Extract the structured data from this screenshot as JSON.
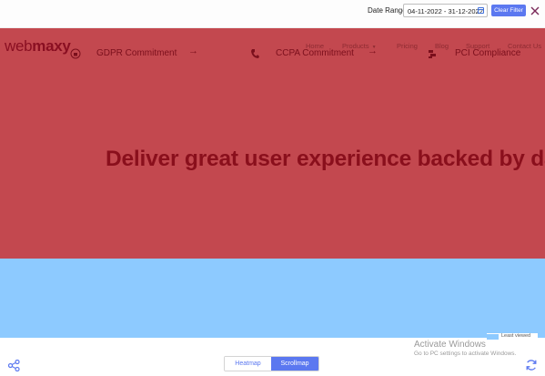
{
  "filter": {
    "label": "Date Range",
    "range": "04-11-2022 - 31-12-2022",
    "clear_label": "Clear Filter"
  },
  "site": {
    "logo_light": "web",
    "logo_bold": "maxy",
    "nav": [
      {
        "label": "Home"
      },
      {
        "label": "Products"
      },
      {
        "label": "Pricing"
      },
      {
        "label": "Blog"
      },
      {
        "label": "Support"
      },
      {
        "label": "Contact Us"
      }
    ],
    "badges": [
      {
        "label": "GDPR Commitment"
      },
      {
        "label": "CCPA Commitment"
      },
      {
        "label": "PCI Compliance"
      }
    ],
    "headline": "Deliver great user experience backed by data"
  },
  "legend_fragment": "Least viewed",
  "watermark": {
    "title": "Activate Windows",
    "subtitle": "Go to PC settings to activate Windows."
  },
  "toggle": {
    "heatmap": "Heatmap",
    "scrollmap": "Scrollmap",
    "active": "Scrollmap"
  },
  "colors": {
    "accent": "#5b78f0",
    "scroll_hot": "#c3484f",
    "scroll_cool": "#8dcaff"
  },
  "icons": {
    "share": "share-icon",
    "refresh": "refresh-icon",
    "close": "close-icon",
    "calendar": "calendar-icon"
  }
}
